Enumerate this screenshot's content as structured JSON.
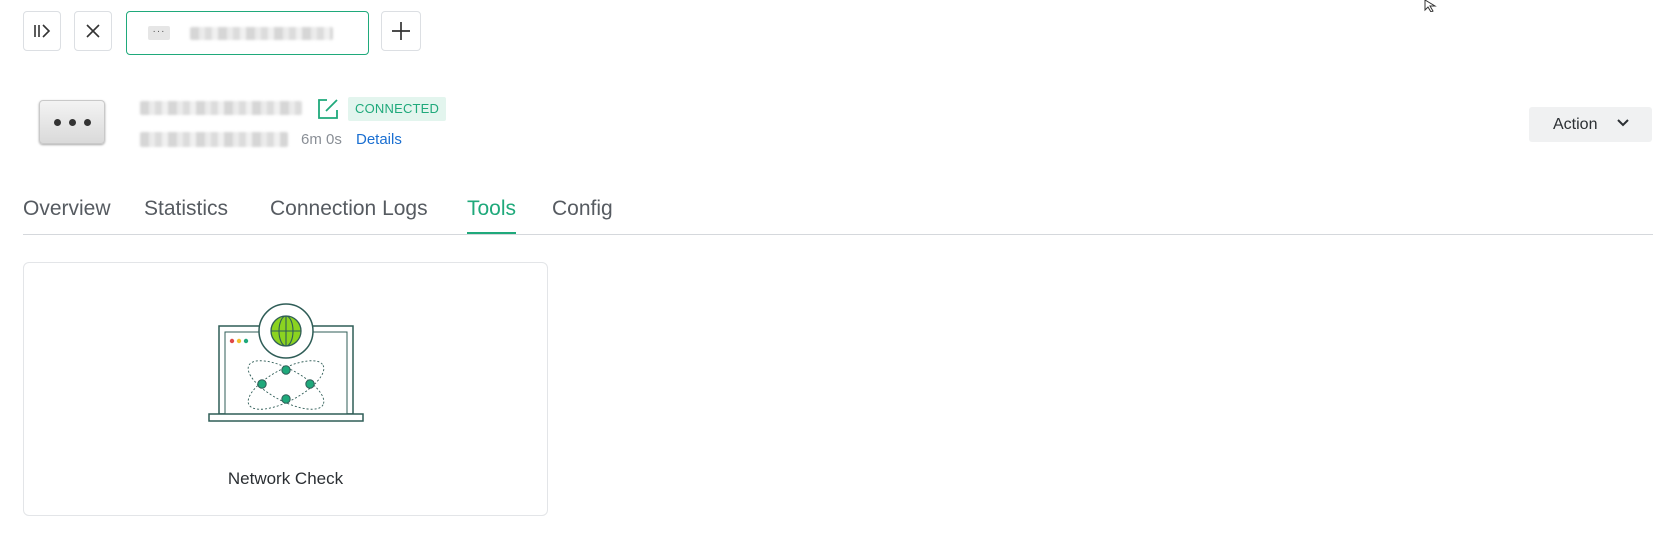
{
  "toolbar": {
    "tab_icon_text": "···"
  },
  "device": {
    "status_badge": "CONNECTED",
    "uptime": "6m 0s",
    "details_link": "Details"
  },
  "action_button": {
    "label": "Action"
  },
  "tabs": [
    {
      "label": "Overview",
      "active": false
    },
    {
      "label": "Statistics",
      "active": false
    },
    {
      "label": "Connection Logs",
      "active": false
    },
    {
      "label": "Tools",
      "active": true
    },
    {
      "label": "Config",
      "active": false
    }
  ],
  "tools": [
    {
      "label": "Network Check",
      "icon": "network-check-icon"
    }
  ],
  "colors": {
    "accent": "#1fa97b",
    "link": "#1a6fd1",
    "globe": "#8bd320"
  }
}
